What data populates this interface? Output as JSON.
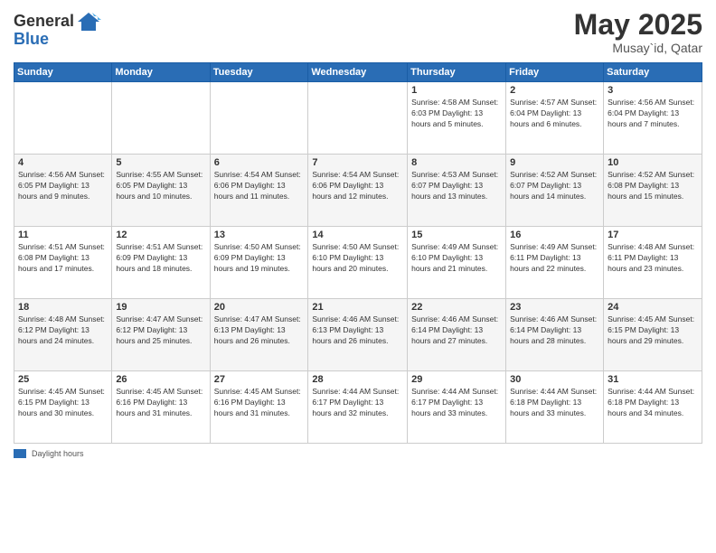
{
  "logo": {
    "general": "General",
    "blue": "Blue"
  },
  "title": {
    "month": "May 2025",
    "location": "Musay`id, Qatar"
  },
  "headers": [
    "Sunday",
    "Monday",
    "Tuesday",
    "Wednesday",
    "Thursday",
    "Friday",
    "Saturday"
  ],
  "footer": {
    "label": "Daylight hours"
  },
  "weeks": [
    {
      "days": [
        {
          "num": "",
          "info": ""
        },
        {
          "num": "",
          "info": ""
        },
        {
          "num": "",
          "info": ""
        },
        {
          "num": "",
          "info": ""
        },
        {
          "num": "1",
          "info": "Sunrise: 4:58 AM\nSunset: 6:03 PM\nDaylight: 13 hours\nand 5 minutes."
        },
        {
          "num": "2",
          "info": "Sunrise: 4:57 AM\nSunset: 6:04 PM\nDaylight: 13 hours\nand 6 minutes."
        },
        {
          "num": "3",
          "info": "Sunrise: 4:56 AM\nSunset: 6:04 PM\nDaylight: 13 hours\nand 7 minutes."
        }
      ]
    },
    {
      "days": [
        {
          "num": "4",
          "info": "Sunrise: 4:56 AM\nSunset: 6:05 PM\nDaylight: 13 hours\nand 9 minutes."
        },
        {
          "num": "5",
          "info": "Sunrise: 4:55 AM\nSunset: 6:05 PM\nDaylight: 13 hours\nand 10 minutes."
        },
        {
          "num": "6",
          "info": "Sunrise: 4:54 AM\nSunset: 6:06 PM\nDaylight: 13 hours\nand 11 minutes."
        },
        {
          "num": "7",
          "info": "Sunrise: 4:54 AM\nSunset: 6:06 PM\nDaylight: 13 hours\nand 12 minutes."
        },
        {
          "num": "8",
          "info": "Sunrise: 4:53 AM\nSunset: 6:07 PM\nDaylight: 13 hours\nand 13 minutes."
        },
        {
          "num": "9",
          "info": "Sunrise: 4:52 AM\nSunset: 6:07 PM\nDaylight: 13 hours\nand 14 minutes."
        },
        {
          "num": "10",
          "info": "Sunrise: 4:52 AM\nSunset: 6:08 PM\nDaylight: 13 hours\nand 15 minutes."
        }
      ]
    },
    {
      "days": [
        {
          "num": "11",
          "info": "Sunrise: 4:51 AM\nSunset: 6:08 PM\nDaylight: 13 hours\nand 17 minutes."
        },
        {
          "num": "12",
          "info": "Sunrise: 4:51 AM\nSunset: 6:09 PM\nDaylight: 13 hours\nand 18 minutes."
        },
        {
          "num": "13",
          "info": "Sunrise: 4:50 AM\nSunset: 6:09 PM\nDaylight: 13 hours\nand 19 minutes."
        },
        {
          "num": "14",
          "info": "Sunrise: 4:50 AM\nSunset: 6:10 PM\nDaylight: 13 hours\nand 20 minutes."
        },
        {
          "num": "15",
          "info": "Sunrise: 4:49 AM\nSunset: 6:10 PM\nDaylight: 13 hours\nand 21 minutes."
        },
        {
          "num": "16",
          "info": "Sunrise: 4:49 AM\nSunset: 6:11 PM\nDaylight: 13 hours\nand 22 minutes."
        },
        {
          "num": "17",
          "info": "Sunrise: 4:48 AM\nSunset: 6:11 PM\nDaylight: 13 hours\nand 23 minutes."
        }
      ]
    },
    {
      "days": [
        {
          "num": "18",
          "info": "Sunrise: 4:48 AM\nSunset: 6:12 PM\nDaylight: 13 hours\nand 24 minutes."
        },
        {
          "num": "19",
          "info": "Sunrise: 4:47 AM\nSunset: 6:12 PM\nDaylight: 13 hours\nand 25 minutes."
        },
        {
          "num": "20",
          "info": "Sunrise: 4:47 AM\nSunset: 6:13 PM\nDaylight: 13 hours\nand 26 minutes."
        },
        {
          "num": "21",
          "info": "Sunrise: 4:46 AM\nSunset: 6:13 PM\nDaylight: 13 hours\nand 26 minutes."
        },
        {
          "num": "22",
          "info": "Sunrise: 4:46 AM\nSunset: 6:14 PM\nDaylight: 13 hours\nand 27 minutes."
        },
        {
          "num": "23",
          "info": "Sunrise: 4:46 AM\nSunset: 6:14 PM\nDaylight: 13 hours\nand 28 minutes."
        },
        {
          "num": "24",
          "info": "Sunrise: 4:45 AM\nSunset: 6:15 PM\nDaylight: 13 hours\nand 29 minutes."
        }
      ]
    },
    {
      "days": [
        {
          "num": "25",
          "info": "Sunrise: 4:45 AM\nSunset: 6:15 PM\nDaylight: 13 hours\nand 30 minutes."
        },
        {
          "num": "26",
          "info": "Sunrise: 4:45 AM\nSunset: 6:16 PM\nDaylight: 13 hours\nand 31 minutes."
        },
        {
          "num": "27",
          "info": "Sunrise: 4:45 AM\nSunset: 6:16 PM\nDaylight: 13 hours\nand 31 minutes."
        },
        {
          "num": "28",
          "info": "Sunrise: 4:44 AM\nSunset: 6:17 PM\nDaylight: 13 hours\nand 32 minutes."
        },
        {
          "num": "29",
          "info": "Sunrise: 4:44 AM\nSunset: 6:17 PM\nDaylight: 13 hours\nand 33 minutes."
        },
        {
          "num": "30",
          "info": "Sunrise: 4:44 AM\nSunset: 6:18 PM\nDaylight: 13 hours\nand 33 minutes."
        },
        {
          "num": "31",
          "info": "Sunrise: 4:44 AM\nSunset: 6:18 PM\nDaylight: 13 hours\nand 34 minutes."
        }
      ]
    }
  ]
}
